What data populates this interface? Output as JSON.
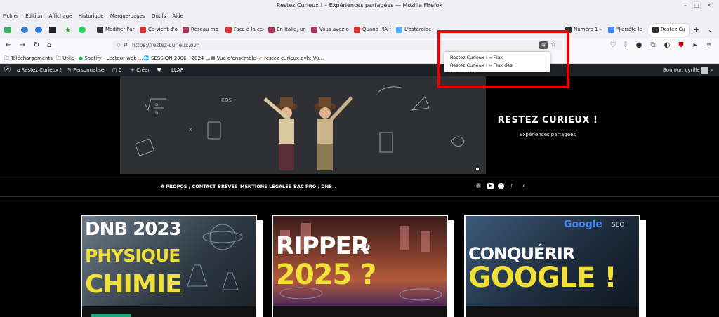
{
  "window": {
    "title": "Restez Curieux ! – Expériences partagées — Mozilla Firefox"
  },
  "menu": [
    "Fichier",
    "Édition",
    "Affichage",
    "Historique",
    "Marque-pages",
    "Outils",
    "Aide"
  ],
  "tabs": [
    {
      "label": "Modifier l'ar",
      "color": "#333"
    },
    {
      "label": "Ça vient d'o",
      "color": "#d33"
    },
    {
      "label": "Réseau mo",
      "color": "#a8365b"
    },
    {
      "label": "Face à la ce",
      "color": "#d33"
    },
    {
      "label": "En Italie, un",
      "color": "#a8365b"
    },
    {
      "label": "Vous avez o",
      "color": "#a8365b"
    },
    {
      "label": "Quand l'IA f",
      "color": "#d33"
    },
    {
      "label": "L'astéroïde",
      "color": "#5af"
    },
    {
      "label": "Numéro 1 –",
      "color": "#333"
    },
    {
      "label": "\"J'arrête le",
      "color": "#4285f4"
    },
    {
      "label": "Restez Cu",
      "color": "#333"
    }
  ],
  "url": "https://restez-curieux.ovh",
  "bookmarks": [
    "Téléchargements",
    "Utile",
    "Spotify - Lecteur web ...",
    "SESSION 2006 - 2024-...",
    "Vue d'ensemble",
    "restez-curieux.ovh: Vu..."
  ],
  "wp": {
    "site": "Restez Curieux !",
    "customize": "Personnaliser",
    "comments": "0",
    "new": "+ Créer",
    "llar": "LLAR",
    "greeting": "Bonjour, cyrille"
  },
  "site": {
    "title": "RESTEZ CURIEUX !",
    "tagline": "Expériences partagées"
  },
  "nav": [
    "À PROPOS / CONTACT",
    "BRÈVES",
    "MENTIONS LÉGALES",
    "BAC PRO / DNB"
  ],
  "feeds": [
    "Restez Curieux ! » Flux",
    "Restez Curieux ! » Flux des commentaires"
  ],
  "cards": [
    {
      "lines": [
        "DNB 2023",
        "PHYSIQUE",
        "CHIMIE"
      ]
    },
    {
      "lines": [
        "RIPPER",
        "en",
        "2025 ?"
      ]
    },
    {
      "lines": [
        "CONQUÉRIR",
        "GOOGLE !"
      ],
      "logo": "Google",
      "seo": "SEO"
    }
  ],
  "hero_math": {
    "cos": "cos",
    "frac_a": "a",
    "frac_b": "b",
    "x": "x"
  }
}
